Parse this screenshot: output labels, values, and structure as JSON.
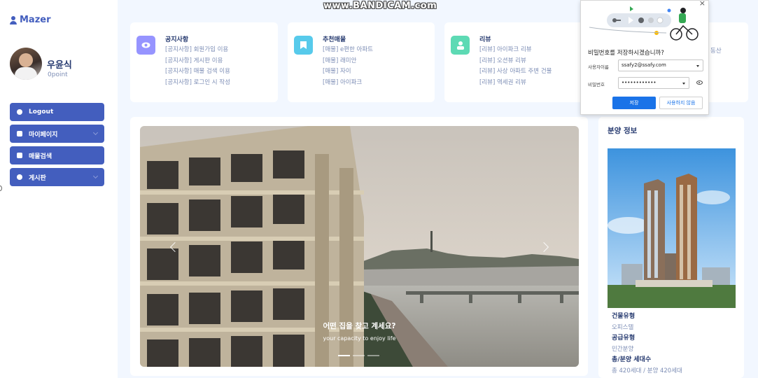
{
  "watermark": "www.BANDICAM.com",
  "sidebar": {
    "logo": "Mazer",
    "user": {
      "name": "우윤식",
      "point": "0point"
    },
    "menu": [
      {
        "label": "Logout"
      },
      {
        "label": "마이페이지"
      },
      {
        "label": "매물검색"
      },
      {
        "label": "게시판"
      }
    ]
  },
  "cards": [
    {
      "title": "공지사항",
      "color": "#9694ff",
      "icon": "eye-icon",
      "items": [
        "[공지사항] 회원가입 이용",
        "[공지사항] 게시판 이용",
        "[공지사항] 매물 검색 이용",
        "[공지사항] 로그인 시 작성"
      ]
    },
    {
      "title": "추천매물",
      "color": "#57caeb",
      "icon": "bookmark-icon",
      "items": [
        "[매물] e편한 아파트",
        "[매물] 래미안",
        "[매물] 자이",
        "[매물] 아이파크"
      ]
    },
    {
      "title": "리뷰",
      "color": "#5ddab4",
      "icon": "user-icon",
      "items": [
        "[리뷰] 아이파크 리뷰",
        "[리뷰] 오션뷰 리뷰",
        "[리뷰] 사상 아파트 주변 건물",
        "[리뷰] 역세권 리뷰"
      ]
    }
  ],
  "card4_fragment": "동산",
  "carousel": {
    "title": "어떤 집을 찾고 계세요?",
    "subtitle": "your capacity to enjoy life",
    "active_index": 0,
    "slide_count": 3
  },
  "info": {
    "title": "분양 정보",
    "fields": [
      {
        "label": "건물유형",
        "value": "오피스텔"
      },
      {
        "label": "공급유형",
        "value": "민간분양"
      },
      {
        "label": "총/분양 세대수",
        "value": "총 420세대 / 분양 420세대"
      }
    ]
  },
  "password_popup": {
    "question": "비밀번호를 저장하시겠습니까?",
    "username_label": "사용자이름",
    "username_value": "ssafy2@ssafy.com",
    "password_label": "비밀번호",
    "password_value": "••••••••••••",
    "save_label": "저장",
    "never_label": "사용하지 않음",
    "close": "×"
  },
  "colors": {
    "primary": "#435ebe",
    "background": "#f2f7ff",
    "save_blue": "#1a73e8"
  }
}
